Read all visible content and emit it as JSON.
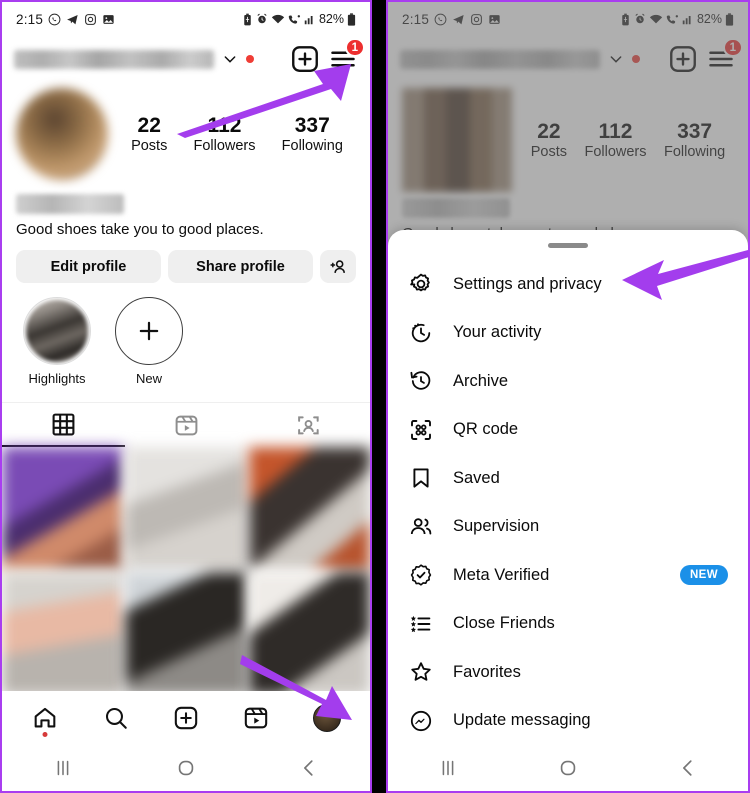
{
  "status_bar": {
    "time": "2:15",
    "left_icons": [
      "whatsapp-icon",
      "telegram-icon",
      "instagram-icon",
      "photos-icon"
    ],
    "right_icons": [
      "battery-saver-icon",
      "alarm-icon",
      "wifi-icon",
      "call-wifi-icon",
      "signal-icon"
    ],
    "battery_percent": "82%"
  },
  "header": {
    "username_blurred": "",
    "dropdown_icon": "chevron-down-icon",
    "notification_dot": "red-dot",
    "add_icon": "plus-square-icon",
    "menu_icon": "hamburger-menu-icon",
    "menu_badge": "1"
  },
  "profile": {
    "stats": [
      {
        "value": "22",
        "label": "Posts"
      },
      {
        "value": "112",
        "label": "Followers"
      },
      {
        "value": "337",
        "label": "Following"
      }
    ],
    "display_name_blurred": "",
    "bio": "Good shoes take you to good places.",
    "buttons": {
      "edit": "Edit profile",
      "share": "Share profile",
      "add_person_icon": "add-person-icon"
    }
  },
  "highlights": [
    {
      "label": "Highlights",
      "type": "cover"
    },
    {
      "label": "New",
      "type": "add"
    }
  ],
  "tabs": [
    {
      "name": "grid-tab",
      "icon": "grid-icon",
      "active": true
    },
    {
      "name": "reels-tab",
      "icon": "reels-icon",
      "active": false
    },
    {
      "name": "tagged-tab",
      "icon": "tagged-icon",
      "active": false
    }
  ],
  "bottom_nav": [
    {
      "name": "home",
      "icon": "home-icon"
    },
    {
      "name": "search",
      "icon": "search-icon"
    },
    {
      "name": "create",
      "icon": "plus-square-icon"
    },
    {
      "name": "reels",
      "icon": "reels-icon"
    },
    {
      "name": "profile",
      "icon": "profile-avatar-icon"
    }
  ],
  "system_nav": [
    {
      "name": "recents",
      "icon": "recents-icon"
    },
    {
      "name": "home",
      "icon": "home-circle-icon"
    },
    {
      "name": "back",
      "icon": "back-chevron-icon"
    }
  ],
  "sheet_menu": [
    {
      "label": "Settings and privacy",
      "icon": "gear-icon",
      "badge": ""
    },
    {
      "label": "Your activity",
      "icon": "activity-icon",
      "badge": ""
    },
    {
      "label": "Archive",
      "icon": "archive-icon",
      "badge": ""
    },
    {
      "label": "QR code",
      "icon": "qr-code-icon",
      "badge": ""
    },
    {
      "label": "Saved",
      "icon": "bookmark-icon",
      "badge": ""
    },
    {
      "label": "Supervision",
      "icon": "people-icon",
      "badge": ""
    },
    {
      "label": "Meta Verified",
      "icon": "verified-icon",
      "badge": "NEW"
    },
    {
      "label": "Close Friends",
      "icon": "close-friends-icon",
      "badge": ""
    },
    {
      "label": "Favorites",
      "icon": "star-icon",
      "badge": ""
    },
    {
      "label": "Update messaging",
      "icon": "messenger-icon",
      "badge": ""
    }
  ],
  "annotations": {
    "arrow_color": "#a33ded",
    "arrows": [
      {
        "name": "arrow-to-hamburger-menu"
      },
      {
        "name": "arrow-to-profile-tab"
      },
      {
        "name": "arrow-to-settings-and-privacy"
      }
    ]
  },
  "colors": {
    "frame_purple": "#a93df0",
    "badge_red": "#ed2f2f",
    "new_badge_blue": "#1b90e8",
    "button_grey": "#efefef"
  }
}
